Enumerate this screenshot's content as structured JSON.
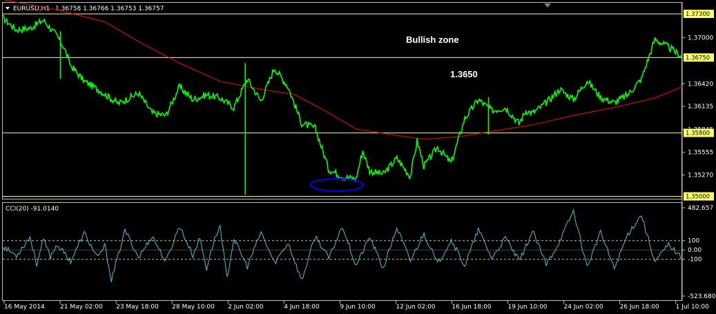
{
  "header": {
    "symbol": "EURUSD,H1",
    "ohlc": "1.36758 1.36766 1.36753 1.36757",
    "arrow_icon": "triangle-down-icon"
  },
  "colors": {
    "background": "#000000",
    "price": "#00ff00",
    "ma": "#ff0000",
    "hline": "#ffff66",
    "cci": "#40c8d8",
    "grid": "#c0c0c0",
    "ellipse": "#0000ff"
  },
  "annotations": {
    "bullish": "Bullish zone",
    "level": "1.3650"
  },
  "price_tags": [
    "1.37300",
    "1.36750",
    "1.35800",
    "1.35000"
  ],
  "chart_data": [
    {
      "type": "line",
      "title": "",
      "y_ticks": [
        "1.37000",
        "1.36420",
        "1.36135",
        "1.35845",
        "1.35555",
        "1.35270"
      ],
      "ylim": [
        1.3497,
        1.3744
      ],
      "horizontal_levels": [
        1.373,
        1.3675,
        1.358,
        1.35
      ],
      "x_labels": [
        "16 May 2014",
        "21 May 02:00",
        "23 May 18:00",
        "28 May 10:00",
        "2 Jun 02:00",
        "4 Jun 18:00",
        "9 Jun 10:00",
        "12 Jun 02:00",
        "16 Jun 18:00",
        "19 Jun 10:00",
        "24 Jun 02:00",
        "26 Jun 18:00",
        "1 Jul 10:00"
      ],
      "series": [
        {
          "name": "",
          "x": [
            0,
            2,
            4,
            6,
            8,
            9,
            10,
            12,
            14,
            17,
            20,
            22,
            24,
            26,
            28,
            30,
            32,
            34,
            36,
            38,
            40,
            42,
            44,
            46,
            48,
            50,
            52,
            53,
            54,
            56,
            58,
            60,
            61,
            62,
            64,
            66,
            68,
            70,
            72,
            74,
            76,
            77,
            78,
            80,
            82,
            84,
            86,
            88,
            90,
            92,
            94,
            96,
            98,
            100
          ],
          "values": [
            1.3725,
            1.371,
            1.3712,
            1.3722,
            1.3702,
            1.3688,
            1.3665,
            1.3645,
            1.3635,
            1.3617,
            1.363,
            1.3605,
            1.3602,
            1.3638,
            1.3622,
            1.3628,
            1.3624,
            1.3612,
            1.3648,
            1.362,
            1.3662,
            1.3638,
            1.3592,
            1.3586,
            1.3534,
            1.3525,
            1.3522,
            1.3558,
            1.3532,
            1.3528,
            1.3548,
            1.3525,
            1.357,
            1.3538,
            1.3562,
            1.3542,
            1.3598,
            1.3622,
            1.3608,
            1.3612,
            1.3592,
            1.3608,
            1.3605,
            1.3618,
            1.3635,
            1.3622,
            1.3646,
            1.3625,
            1.3618,
            1.3628,
            1.3648,
            1.3698,
            1.3688,
            1.3676
          ]
        },
        {
          "name": "",
          "x": [
            0,
            8,
            15,
            20,
            26,
            32,
            38,
            43,
            47,
            52,
            57,
            62,
            67,
            72,
            78,
            84,
            90,
            96,
            100
          ],
          "values": [
            1.3748,
            1.3735,
            1.372,
            1.3695,
            1.3668,
            1.3645,
            1.3635,
            1.3628,
            1.361,
            1.3585,
            1.3578,
            1.3572,
            1.3575,
            1.3582,
            1.359,
            1.3602,
            1.3612,
            1.3624,
            1.3638
          ]
        }
      ]
    },
    {
      "type": "line",
      "title": "CCI(20) -91.0140",
      "ylim": [
        -523.6804,
        482.657
      ],
      "y_ticks": [
        "482.657",
        "100",
        "0.00",
        "-100",
        "-523.6804"
      ],
      "levels": [
        100,
        0,
        -100
      ],
      "series": [
        {
          "name": "",
          "x": [
            0,
            2,
            4,
            5,
            6,
            7,
            8,
            10,
            12,
            14,
            15,
            16,
            18,
            20,
            22,
            24,
            26,
            28,
            29,
            30,
            31,
            32,
            33,
            34,
            36,
            38,
            40,
            42,
            44,
            46,
            48,
            50,
            52,
            54,
            56,
            58,
            60,
            62,
            64,
            66,
            68,
            70,
            72,
            74,
            76,
            78,
            80,
            82,
            84,
            86,
            88,
            90,
            92,
            94,
            96,
            98,
            100
          ],
          "values": [
            40,
            -60,
            140,
            -150,
            110,
            -70,
            60,
            -120,
            180,
            -90,
            50,
            -320,
            210,
            -80,
            150,
            -130,
            260,
            -60,
            130,
            -200,
            80,
            260,
            -310,
            120,
            -180,
            190,
            -140,
            80,
            -330,
            150,
            -90,
            260,
            -170,
            140,
            -200,
            240,
            -120,
            180,
            -150,
            110,
            -170,
            220,
            -90,
            130,
            -120,
            200,
            -160,
            100,
            420,
            -180,
            190,
            -200,
            170,
            380,
            -130,
            60,
            -91
          ]
        }
      ]
    }
  ]
}
